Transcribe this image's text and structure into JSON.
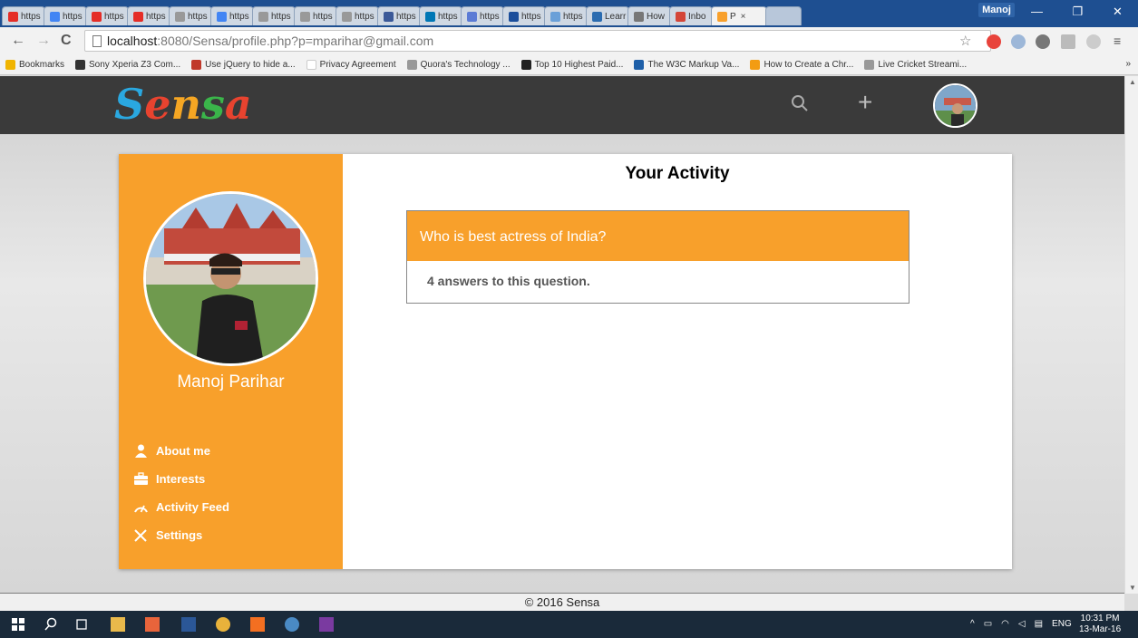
{
  "browser": {
    "tabs": [
      {
        "label": "https",
        "color": "#e52d27"
      },
      {
        "label": "https",
        "color": "#4285f4"
      },
      {
        "label": "https",
        "color": "#e52d27"
      },
      {
        "label": "https",
        "color": "#e52d27"
      },
      {
        "label": "https",
        "color": "#999999"
      },
      {
        "label": "https",
        "color": "#4285f4"
      },
      {
        "label": "https",
        "color": "#999999"
      },
      {
        "label": "https",
        "color": "#999999"
      },
      {
        "label": "https",
        "color": "#999999"
      },
      {
        "label": "https",
        "color": "#3b5998"
      },
      {
        "label": "https",
        "color": "#0077b5"
      },
      {
        "label": "https",
        "color": "#5b7bd5"
      },
      {
        "label": "https",
        "color": "#1b4e9b"
      },
      {
        "label": "https",
        "color": "#6aa0d8"
      },
      {
        "label": "Learr",
        "color": "#2b6cb0"
      },
      {
        "label": "How",
        "color": "#777777"
      },
      {
        "label": "Inbo",
        "color": "#d44638"
      }
    ],
    "active_tab": {
      "label": "P",
      "close": "×"
    },
    "profile_name": "Manoj",
    "window_controls": {
      "minimize": "—",
      "restore": "❐",
      "close": "✕"
    },
    "url_host": "localhost",
    "url_rest": ":8080/Sensa/profile.php?p=mparihar@gmail.com",
    "bookmarks": [
      {
        "label": "Bookmarks",
        "icon": "star-icon"
      },
      {
        "label": "Sony Xperia Z3 Com...",
        "icon": "phone-icon"
      },
      {
        "label": "Use jQuery to hide a...",
        "icon": "cs-icon"
      },
      {
        "label": "Privacy Agreement",
        "icon": "blank-page-icon"
      },
      {
        "label": "Quora's Technology ...",
        "icon": "page-icon"
      },
      {
        "label": "Top 10 Highest Paid...",
        "icon": "fw-icon"
      },
      {
        "label": "The W3C Markup Va...",
        "icon": "w3c-icon"
      },
      {
        "label": "How to Create a Chr...",
        "icon": "arrow-icon"
      },
      {
        "label": "Live Cricket Streami...",
        "icon": "page-icon"
      }
    ],
    "bookmarks_more": "»"
  },
  "site": {
    "logo_letters": [
      {
        "ch": "S",
        "color": "#2aa8e0"
      },
      {
        "ch": "e",
        "color": "#e8432f"
      },
      {
        "ch": "n",
        "color": "#f5a623"
      },
      {
        "ch": "s",
        "color": "#3ab54a"
      },
      {
        "ch": "a",
        "color": "#e8432f"
      }
    ],
    "nav_plus": "+",
    "profile": {
      "name": "Manoj Parihar"
    },
    "menu": [
      {
        "label": "About me",
        "icon": "user-icon"
      },
      {
        "label": "Interests",
        "icon": "briefcase-icon"
      },
      {
        "label": "Activity Feed",
        "icon": "dashboard-icon"
      },
      {
        "label": "Settings",
        "icon": "tools-icon"
      }
    ],
    "activity_title": "Your Activity",
    "question": {
      "title": "Who is best actress of India?",
      "answers_text": "4 answers to this question."
    },
    "footer": "© 2016 Sensa",
    "accent_color": "#f8a02b"
  },
  "taskbar": {
    "lang": "ENG",
    "time": "10:31 PM",
    "date": "13-Mar-16"
  }
}
